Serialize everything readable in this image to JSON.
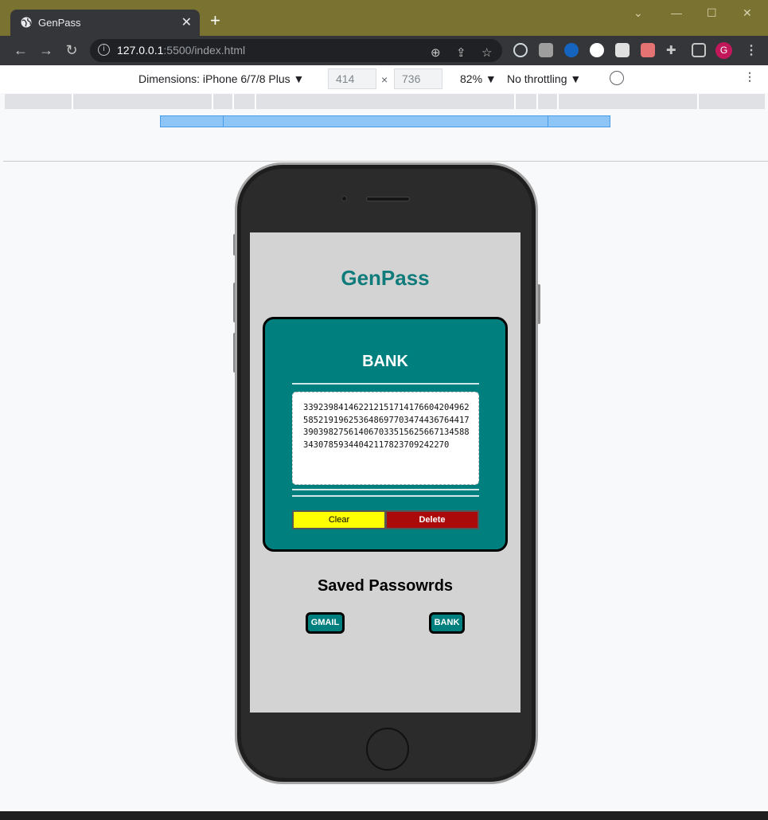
{
  "browser": {
    "tab_title": "GenPass",
    "tab_close": "✕",
    "new_tab": "+",
    "url_host": "127.0.0.1",
    "url_rest": ":5500/index.html",
    "window_controls": [
      "⌄",
      "—",
      "☐",
      "✕"
    ],
    "profile_initial": "G",
    "menu": "⋮"
  },
  "devtools": {
    "dimensions_label": "Dimensions: iPhone 6/7/8 Plus ▼",
    "width": "414",
    "times": "×",
    "height": "736",
    "zoom": "82% ▼",
    "throttle": "No throttling ▼",
    "menu": "⋮"
  },
  "app": {
    "title": "GenPass",
    "card": {
      "title": "BANK",
      "password": "3392398414622121517141766042049625852191962536486977034744367644173903982756140670335156256671345883430785934404211782370924227​0",
      "clear_label": "Clear",
      "delete_label": "Delete"
    },
    "saved_title": "Saved Passowrds",
    "saved": [
      {
        "label": "GMAIL"
      },
      {
        "label": "BANK"
      }
    ]
  },
  "colors": {
    "teal": "#007f7f",
    "title_teal": "#0f7b7b",
    "clear_yellow": "#ffff00",
    "delete_red": "#aa0a0a"
  }
}
